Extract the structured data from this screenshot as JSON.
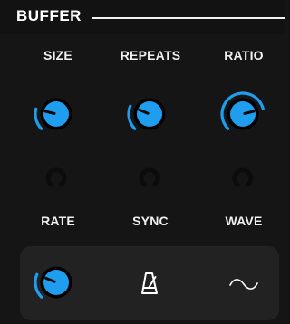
{
  "section": {
    "title": "BUFFER"
  },
  "knobs": [
    {
      "label": "SIZE",
      "value": 0.22
    },
    {
      "label": "REPEATS",
      "value": 0.25
    },
    {
      "label": "RATIO",
      "value": 0.78
    },
    {
      "label": "RATE",
      "value": 0.25
    }
  ],
  "controls": [
    {
      "label": "SYNC",
      "icon": "metronome-icon"
    },
    {
      "label": "WAVE",
      "icon": "sine-wave-icon"
    }
  ],
  "colors": {
    "accent": "#1f9ef0",
    "background": "#151515",
    "panel": "#222222",
    "mod_ring": "#0c0c0c",
    "text": "#ffffff"
  }
}
